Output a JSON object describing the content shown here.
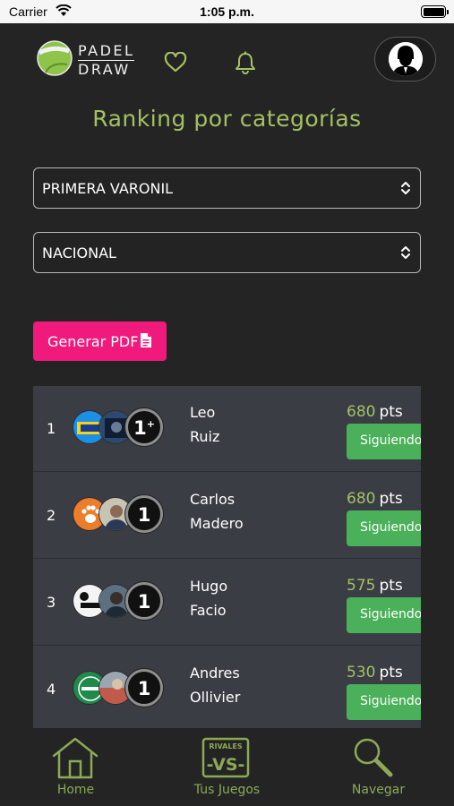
{
  "status_bar": {
    "carrier": "Carrier",
    "time": "1:05 p.m."
  },
  "header": {
    "brand_line1": "PADEL",
    "brand_line2": "DRAW",
    "accent_color": "#a3c164"
  },
  "page_title": "Ranking por categorías",
  "filters": {
    "category": "PRIMERA VARONIL",
    "scope": "NACIONAL"
  },
  "pdf_button": {
    "label": "Generar PDF",
    "color": "#ef1a7c"
  },
  "ranking": {
    "points_unit": "pts",
    "follow_color": "#4bb05a",
    "rows": [
      {
        "position": "1",
        "first_name": "Leo",
        "last_name": "Ruiz",
        "category": "1",
        "category_suffix": "+",
        "points": "680",
        "follow_label": "Siguiendo"
      },
      {
        "position": "2",
        "first_name": "Carlos",
        "last_name": "Madero",
        "category": "1",
        "points": "680",
        "follow_label": "Siguiendo"
      },
      {
        "position": "3",
        "first_name": "Hugo",
        "last_name": "Facio",
        "category": "1",
        "points": "575",
        "follow_label": "Siguiendo"
      },
      {
        "position": "4",
        "first_name": "Andres",
        "last_name": "Ollivier",
        "category": "1",
        "points": "530",
        "follow_label": "Siguiendo"
      }
    ]
  },
  "tabbar": {
    "home": "Home",
    "games": "Tus Juegos",
    "games_icon_top": "RIVALES",
    "games_icon_main": "-VS-",
    "browse": "Navegar"
  }
}
